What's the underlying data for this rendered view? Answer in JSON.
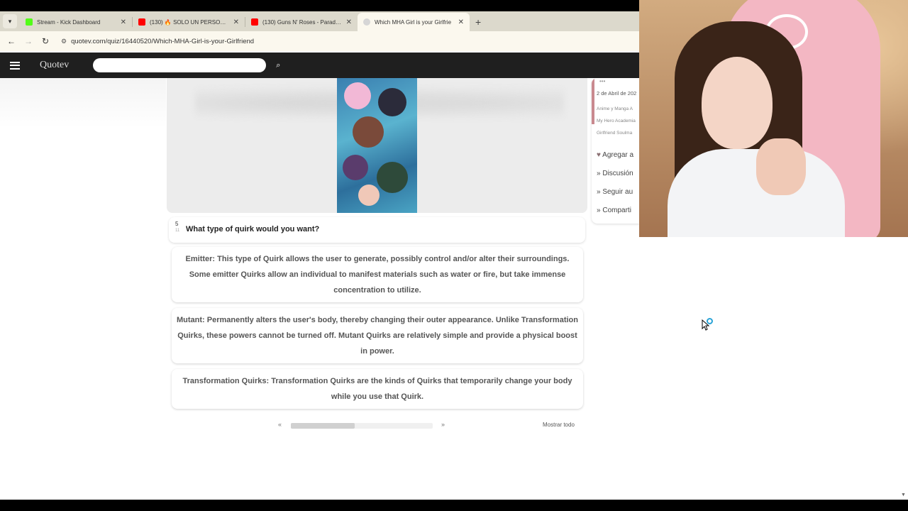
{
  "tabs": [
    {
      "title": "Stream - Kick Dashboard",
      "favicon_color": "#53fc18"
    },
    {
      "title": "(130) 🔥 SOLO UN PERSONAJE",
      "favicon_color": "#ff0000"
    },
    {
      "title": "(130) Guns N' Roses - Paradise",
      "favicon_color": "#ff0000"
    },
    {
      "title": "Which MHA Girl is your Girlfrie",
      "favicon_color": "#d6d6d6"
    }
  ],
  "addressbar": {
    "url": "quotev.com/quiz/16440520/Which-MHA-Girl-is-your-Girlfriend"
  },
  "header": {
    "logo": "Quotev",
    "search_placeholder": ""
  },
  "question": {
    "number": "5",
    "sub": "11",
    "text": "What type of quirk would you want?"
  },
  "answers": [
    {
      "label": "Emitter:",
      "text": "This type of Quirk allows the user to generate, possibly control and/or alter their surroundings. Some emitter Quirks allow an individual to manifest materials such as water or fire, but take immense concentration to utilize."
    },
    {
      "label": "Mutant:",
      "text": "Permanently alters the user's body, thereby changing their outer appearance. Unlike Transformation Quirks, these powers cannot be turned off. Mutant Quirks are relatively simple and provide a physical boost in power."
    },
    {
      "label": "Transformation Quirks:",
      "text": "Transformation Quirks are the kinds of Quirks that temporarily change your body while you use that Quirk."
    }
  ],
  "pager": {
    "prev": "«",
    "next": "»",
    "show_all": "Mostrar todo",
    "progress": 0.45
  },
  "sidebar": {
    "menu_dots": "•••",
    "date": "2 de Abril de 202",
    "tags_line1": "Anime y Manga   A",
    "tags_line2": "My Hero Academia",
    "tags_line3": "Girlfriend   Soulma",
    "links": [
      "Agregar a",
      "Discusión",
      "Seguir au",
      "Comparti"
    ]
  },
  "icons": {
    "tab_menu": "chevron-down-icon",
    "close": "close-icon",
    "new_tab": "plus-icon",
    "back": "back-arrow-icon",
    "forward": "forward-arrow-icon",
    "reload": "reload-icon",
    "site_settings": "tune-icon",
    "menu": "hamburger-icon",
    "search": "search-icon",
    "heart": "heart-icon"
  },
  "colors": {
    "header_bg": "#1f1f1f",
    "tabbar_bg": "#dcd9cc",
    "accent_pink": "#c9898f"
  }
}
